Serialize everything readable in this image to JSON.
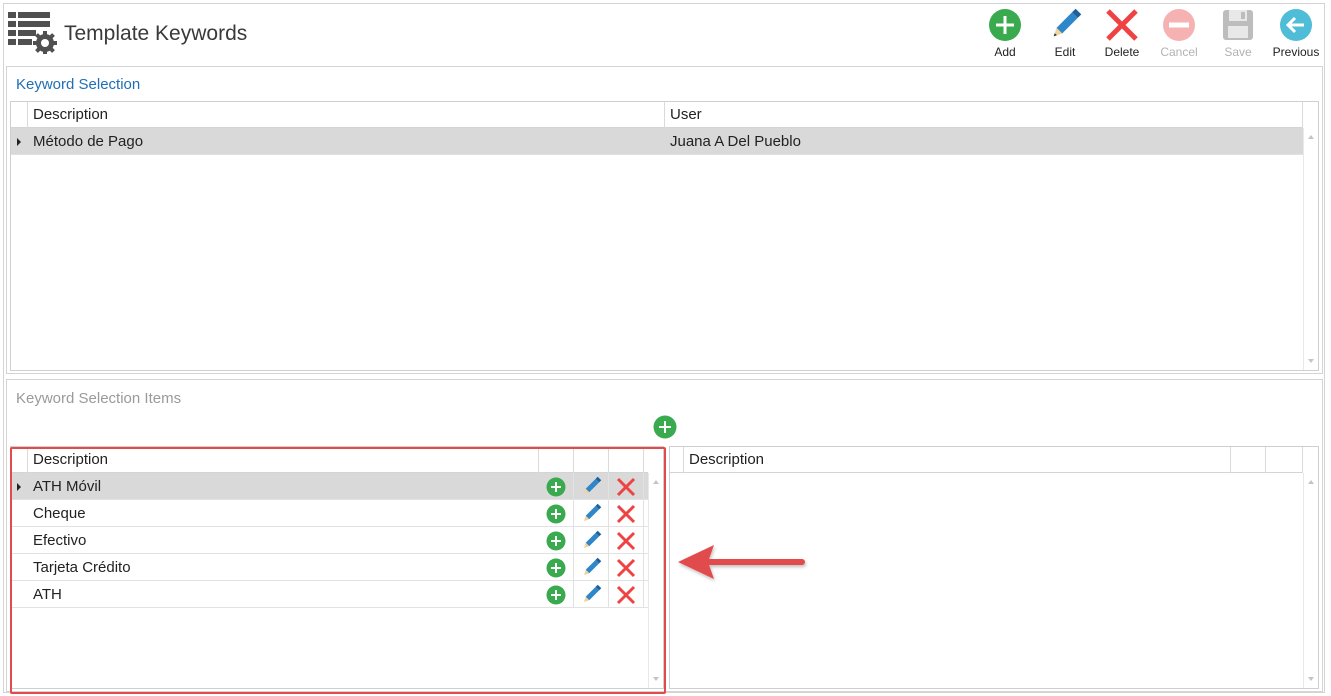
{
  "header": {
    "title": "Template Keywords",
    "toolbar": {
      "add": "Add",
      "edit": "Edit",
      "delete": "Delete",
      "cancel": "Cancel",
      "save": "Save",
      "previous": "Previous"
    }
  },
  "keyword_selection": {
    "title": "Keyword Selection",
    "columns": [
      "Description",
      "User"
    ],
    "rows": [
      {
        "description": "Método de Pago",
        "user": "Juana A Del Pueblo",
        "selected": true
      }
    ]
  },
  "keyword_selection_items": {
    "title": "Keyword Selection Items",
    "left_grid": {
      "columns": [
        "Description"
      ],
      "rows": [
        {
          "description": "ATH Móvil",
          "selected": true
        },
        {
          "description": "Cheque",
          "selected": false
        },
        {
          "description": "Efectivo",
          "selected": false
        },
        {
          "description": "Tarjeta Crédito",
          "selected": false
        },
        {
          "description": "ATH",
          "selected": false
        }
      ]
    },
    "right_grid": {
      "columns": [
        "Description"
      ]
    }
  },
  "colors": {
    "add_green": "#3aaa4e",
    "edit_blue": "#2f86c8",
    "delete_red": "#ef4343",
    "link_blue": "#1f6fb5",
    "annotation_red": "#e24b4b"
  },
  "icons": {
    "app": "grid-gear-icon",
    "add": "plus-circle-icon",
    "edit": "pencil-icon",
    "delete": "x-icon",
    "cancel": "minus-circle-icon",
    "save": "floppy-disk-icon",
    "previous": "arrow-left-circle-icon"
  }
}
